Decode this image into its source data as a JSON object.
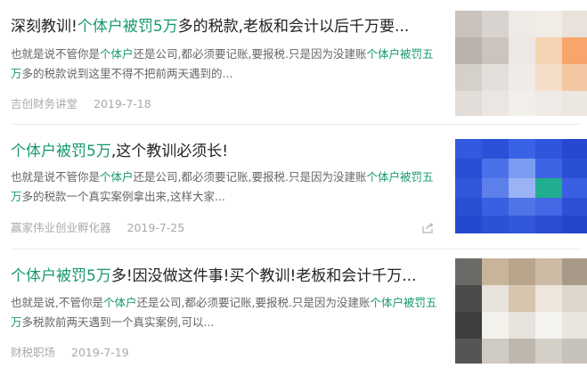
{
  "items": [
    {
      "title_parts": [
        "深刻教训!",
        "个体户被罚5万",
        "多的税款,老板和会计以后千万要..."
      ],
      "summary_parts": [
        "也就是说不管你是",
        "个体户",
        "还是公司,都必须要记账,要报税.只是因为没建账",
        "个体户被罚五万",
        "多的税款说到这里不得不把前两天遇到的..."
      ],
      "source": "吉创财务讲堂",
      "date": "2019-7-18"
    },
    {
      "title_parts": [
        "",
        "个体户被罚5万",
        ",这个教训必须长!"
      ],
      "summary_parts": [
        "也就是说不管你是",
        "个体户",
        "还是公司,都必须要记账,要报税.只是因为没建账",
        "个体户被罚五万",
        "多的税款一个真实案例拿出来,这样大家..."
      ],
      "source": "赢家伟业创业孵化器",
      "date": "2019-7-25",
      "share_icon": "share-icon"
    },
    {
      "title_parts": [
        "",
        "个体户被罚5万",
        "多!因没做这件事!买个教训!老板和会计千万..."
      ],
      "summary_parts": [
        "也就是说,不管你是",
        "个体户",
        "还是公司,都必须要记账,要报税.只是因为没建账",
        "个体户被罚五万",
        "多税款前两天遇到一个真实案例,可以..."
      ],
      "source": "财税职场",
      "date": "2019-7-19"
    }
  ],
  "colors": {
    "highlight": "#179a6a",
    "title": "#222222",
    "summary": "#666666",
    "meta": "#aaaaaa"
  }
}
